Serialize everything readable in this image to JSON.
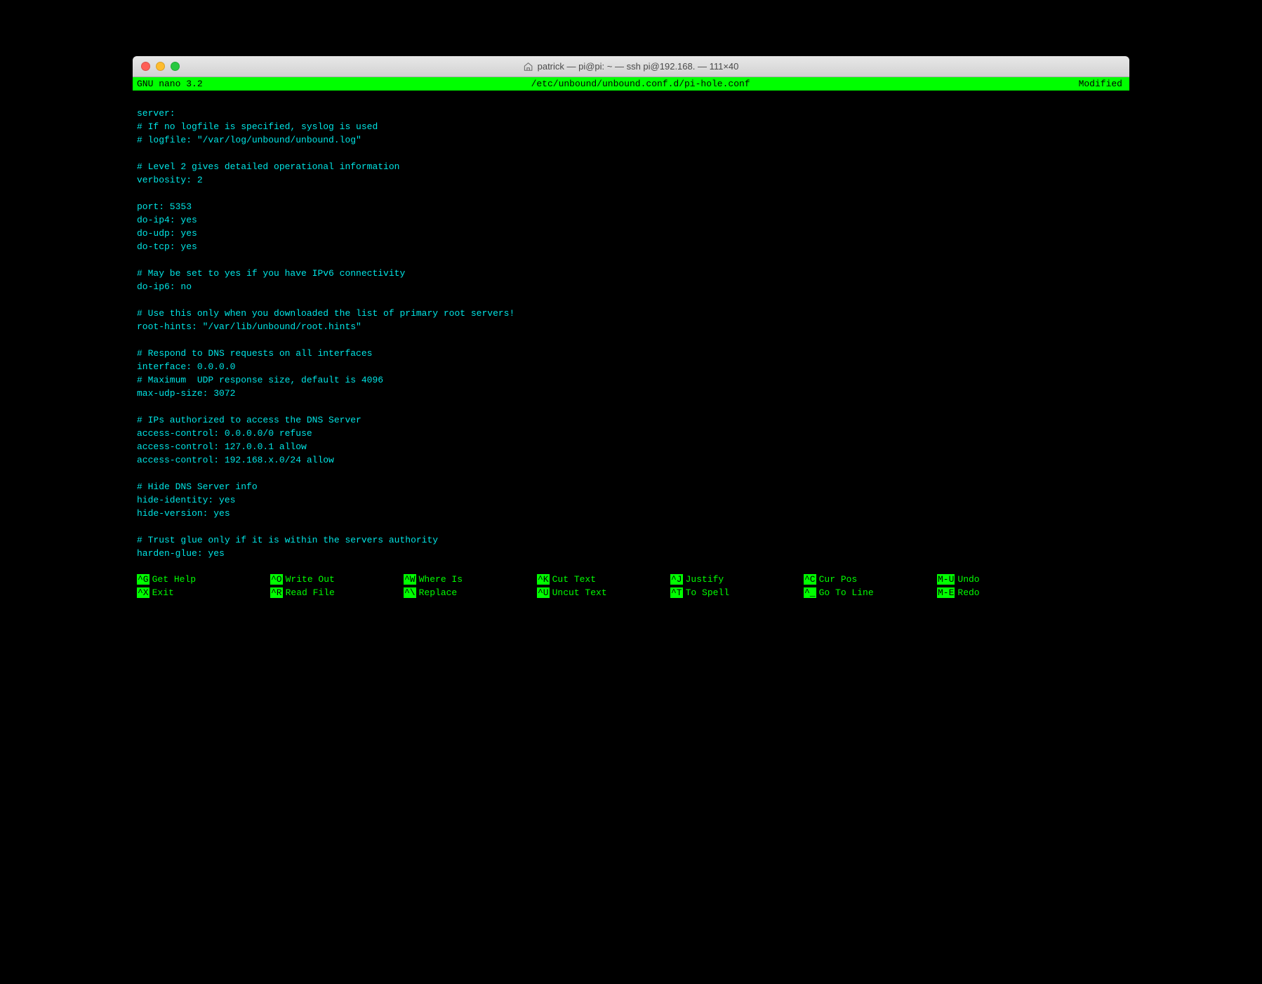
{
  "titlebar": {
    "title": "patrick — pi@pi: ~ — ssh pi@192.168.      — 111×40"
  },
  "statusbar": {
    "left": "  GNU nano 3.2",
    "center": "/etc/unbound/unbound.conf.d/pi-hole.conf",
    "right": "Modified "
  },
  "content": "\nserver:\n# If no logfile is specified, syslog is used\n# logfile: \"/var/log/unbound/unbound.log\"\n\n# Level 2 gives detailed operational information\nverbosity: 2\n\nport: 5353\ndo-ip4: yes\ndo-udp: yes\ndo-tcp: yes\n\n# May be set to yes if you have IPv6 connectivity\ndo-ip6: no\n\n# Use this only when you downloaded the list of primary root servers!\nroot-hints: \"/var/lib/unbound/root.hints\"\n\n# Respond to DNS requests on all interfaces\ninterface: 0.0.0.0\n# Maximum  UDP response size, default is 4096\nmax-udp-size: 3072\n\n# IPs authorized to access the DNS Server\naccess-control: 0.0.0.0/0 refuse\naccess-control: 127.0.0.1 allow\naccess-control: 192.168.x.0/24 allow\n\n# Hide DNS Server info\nhide-identity: yes\nhide-version: yes\n\n# Trust glue only if it is within the servers authority\nharden-glue: yes\n",
  "menu": {
    "row1": [
      {
        "key": "^G",
        "label": "Get Help"
      },
      {
        "key": "^O",
        "label": "Write Out"
      },
      {
        "key": "^W",
        "label": "Where Is"
      },
      {
        "key": "^K",
        "label": "Cut Text"
      },
      {
        "key": "^J",
        "label": "Justify"
      },
      {
        "key": "^C",
        "label": "Cur Pos"
      },
      {
        "key": "M-U",
        "label": "Undo"
      }
    ],
    "row2": [
      {
        "key": "^X",
        "label": "Exit"
      },
      {
        "key": "^R",
        "label": "Read File"
      },
      {
        "key": "^\\",
        "label": "Replace"
      },
      {
        "key": "^U",
        "label": "Uncut Text"
      },
      {
        "key": "^T",
        "label": "To Spell"
      },
      {
        "key": "^_",
        "label": "Go To Line"
      },
      {
        "key": "M-E",
        "label": "Redo"
      }
    ]
  }
}
